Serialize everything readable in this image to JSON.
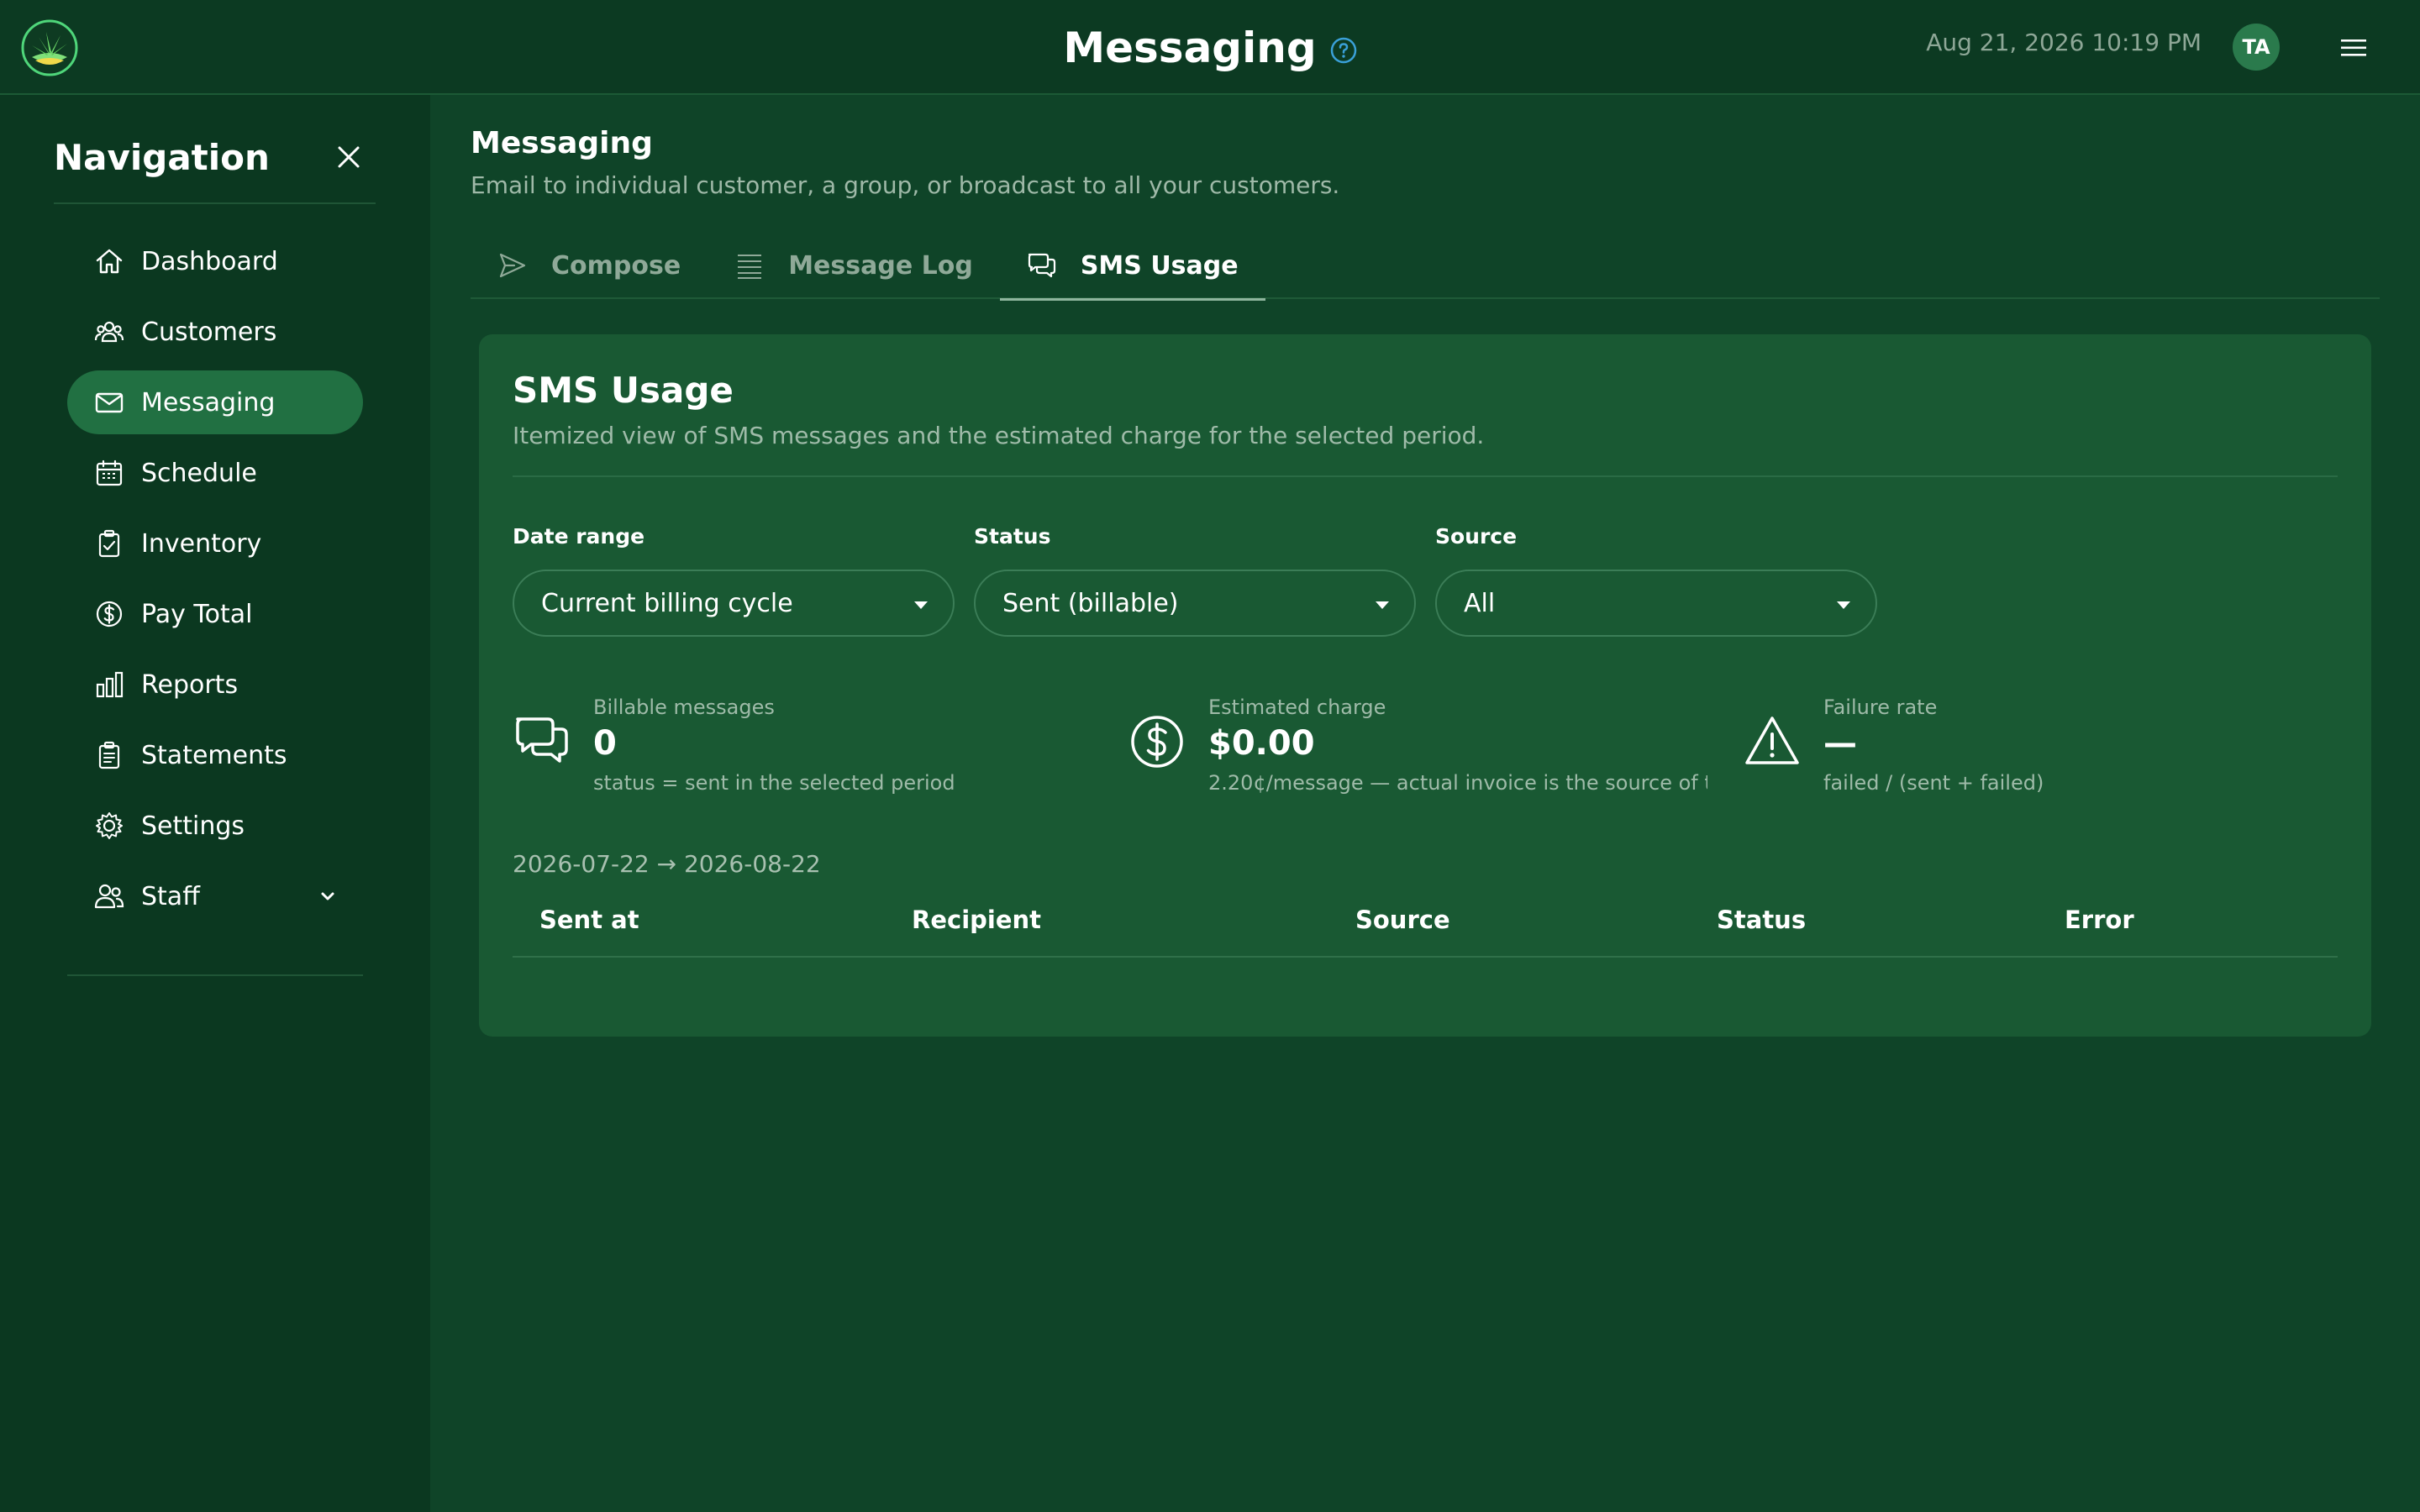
{
  "header": {
    "title": "Messaging",
    "datetime": "Aug 21, 2026 10:19 PM",
    "avatar_initials": "TA"
  },
  "sidebar": {
    "title": "Navigation",
    "items": [
      {
        "label": "Dashboard",
        "icon": "home-icon"
      },
      {
        "label": "Customers",
        "icon": "users-icon"
      },
      {
        "label": "Messaging",
        "icon": "mail-icon",
        "active": true
      },
      {
        "label": "Schedule",
        "icon": "calendar-icon"
      },
      {
        "label": "Inventory",
        "icon": "clipboard-icon"
      },
      {
        "label": "Pay Total",
        "icon": "dollar-icon"
      },
      {
        "label": "Reports",
        "icon": "bar-chart-icon"
      },
      {
        "label": "Statements",
        "icon": "document-icon"
      },
      {
        "label": "Settings",
        "icon": "gear-icon"
      },
      {
        "label": "Staff",
        "icon": "staff-icon",
        "expandable": true
      }
    ]
  },
  "page": {
    "heading": "Messaging",
    "subtitle": "Email to individual customer, a group, or broadcast to all your customers."
  },
  "tabs": [
    {
      "label": "Compose",
      "icon": "send-icon"
    },
    {
      "label": "Message Log",
      "icon": "list-icon"
    },
    {
      "label": "SMS Usage",
      "icon": "chat-icon",
      "active": true
    }
  ],
  "card": {
    "title": "SMS Usage",
    "subtitle": "Itemized view of SMS messages and the estimated charge for the selected period."
  },
  "filters": {
    "date_range": {
      "label": "Date range",
      "value": "Current billing cycle"
    },
    "status": {
      "label": "Status",
      "value": "Sent (billable)"
    },
    "source": {
      "label": "Source",
      "value": "All"
    }
  },
  "stats": {
    "billable": {
      "label": "Billable messages",
      "value": "0",
      "note": "status = sent in the selected period"
    },
    "charge": {
      "label": "Estimated charge",
      "value": "$0.00",
      "note": "2.20¢/message — actual invoice is the source of t"
    },
    "failure": {
      "label": "Failure rate",
      "value": "—",
      "note": "failed / (sent + failed)"
    }
  },
  "range_text": "2026-07-22 → 2026-08-22",
  "table": {
    "headers": [
      "Sent at",
      "Recipient",
      "Source",
      "Status",
      "Error"
    ],
    "rows": []
  },
  "colors": {
    "background": "#0f4428",
    "sidebar": "#0b3820",
    "card": "#195933",
    "active_nav": "#217042",
    "help_accent": "#3aa0d8"
  }
}
